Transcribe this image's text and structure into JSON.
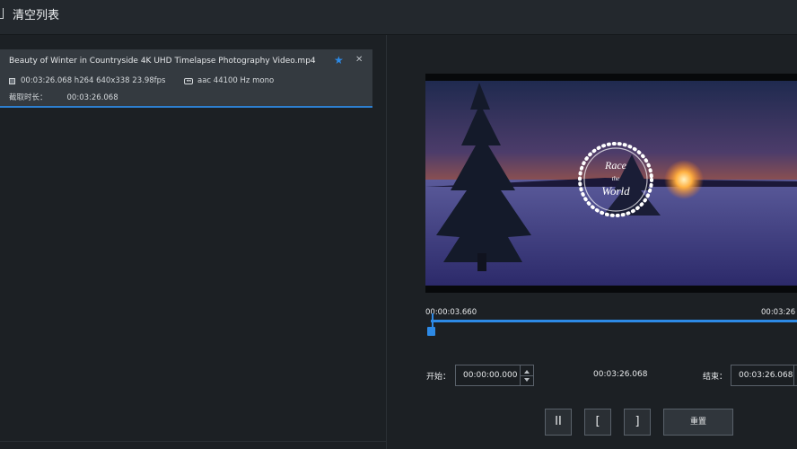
{
  "toolbar": {
    "clear_list_label": "清空列表"
  },
  "file_list": {
    "items": [
      {
        "filename": "Beauty of Winter in Countryside 4K UHD Timelapse Photography Video.mp4",
        "video_info": "00:03:26.068 h264 640x338 23.98fps",
        "audio_info": "aac 44100 Hz mono",
        "duration_label": "截取时长：",
        "duration_value": "00:03:26.068",
        "starred": true
      }
    ]
  },
  "preview": {
    "overlay_logo_lines": [
      "Race",
      "the",
      "World"
    ]
  },
  "timeline": {
    "current_time": "00:00:03.660",
    "end_time": "00:03:26"
  },
  "trim": {
    "start_label": "开始：",
    "start_value": "00:00:00.000",
    "duration_value": "00:03:26.068",
    "end_label": "结束：",
    "end_value": "00:03:26.068"
  },
  "controls": {
    "pause_label": "II",
    "set_start_label": "[",
    "set_end_label": "]",
    "reset_label": "重置"
  },
  "colors": {
    "accent": "#2d8ae6",
    "background": "#1c2024",
    "selected_item": "#343a40"
  }
}
